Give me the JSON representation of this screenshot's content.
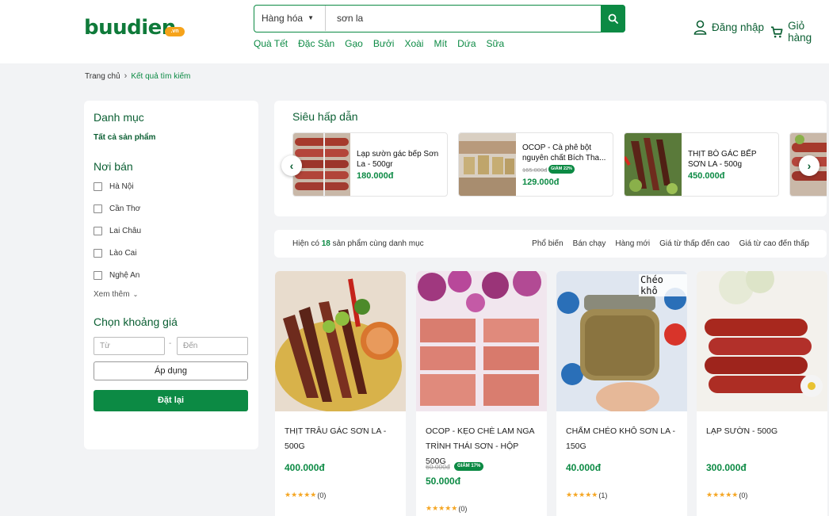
{
  "header": {
    "logo_text": "buudien",
    "logo_badge": ".vn",
    "search": {
      "category": "Hàng hóa",
      "query": "sơn la"
    },
    "quick_links": [
      "Quà Tết",
      "Đặc Sản",
      "Gạo",
      "Bưởi",
      "Xoài",
      "Mít",
      "Dứa",
      "Sữa"
    ],
    "login_label": "Đăng nhập",
    "cart_label": "Giỏ hàng"
  },
  "breadcrumb": {
    "home": "Trang chủ",
    "current": "Kết quả tìm kiếm"
  },
  "sidebar": {
    "category_title": "Danh mục",
    "all_categories": "Tất cả sản phẩm",
    "seller_title": "Nơi bán",
    "locations": [
      "Hà Nội",
      "Cần Thơ",
      "Lai Châu",
      "Lào Cai",
      "Nghệ An"
    ],
    "see_more": "Xem thêm",
    "price_title": "Chọn khoảng giá",
    "price_from_placeholder": "Từ",
    "price_to_placeholder": "Đến",
    "apply_label": "Áp dụng",
    "reset_label": "Đặt lại"
  },
  "promo": {
    "title": "Siêu hấp dẫn",
    "items": [
      {
        "name": "Lạp sườn gác bếp Sơn La - 500gr",
        "price": "180.000đ",
        "old_price": "",
        "badge": ""
      },
      {
        "name": "OCOP - Cà phê bột nguyên chất Bích Tha...",
        "price": "129.000đ",
        "old_price": "165.000đ",
        "badge": "GIẢM 22%"
      },
      {
        "name": "THỊT BÒ GÁC BẾP SƠN LA - 500g",
        "price": "450.000đ",
        "old_price": "",
        "badge": ""
      }
    ]
  },
  "results": {
    "prefix": "Hiện có",
    "count": "18",
    "suffix": "sản phẩm cùng danh mục",
    "sort_options": [
      "Phổ biến",
      "Bán chạy",
      "Hàng mới",
      "Giá từ thấp đến cao",
      "Giá từ cao đến thấp"
    ]
  },
  "products": [
    {
      "name": "THỊT TRÂU GÁC SƠN LA - 500g",
      "price": "400.000đ",
      "old_price": "",
      "badge": "",
      "rating_count": "(0)",
      "overlay": ""
    },
    {
      "name": "OCOP - KẸO CHÈ LAM NGA TRÌNH THÁI SƠN - HỘP 500G",
      "price": "50.000đ",
      "old_price": "60.000đ",
      "badge": "GIẢM 17%",
      "rating_count": "(0)",
      "overlay": ""
    },
    {
      "name": "CHẨM CHÉO KHÔ SƠN LA - 150G",
      "price": "40.000đ",
      "old_price": "",
      "badge": "",
      "rating_count": "(1)",
      "overlay": "Chéo khô"
    },
    {
      "name": "LẠP SƯỜN - 500g",
      "price": "300.000đ",
      "old_price": "",
      "badge": "",
      "rating_count": "(0)",
      "overlay": ""
    }
  ],
  "stars": "★★★★★",
  "icons": [
    "search-icon",
    "user-icon",
    "cart-icon",
    "chevron-right-icon",
    "chevron-left-icon",
    "chevron-down-icon",
    "star-icon"
  ],
  "colors": {
    "brand_green": "#0c8a44",
    "dark_green": "#0b5f33",
    "star": "#f5a623",
    "logo_badge": "#f6a31a"
  }
}
